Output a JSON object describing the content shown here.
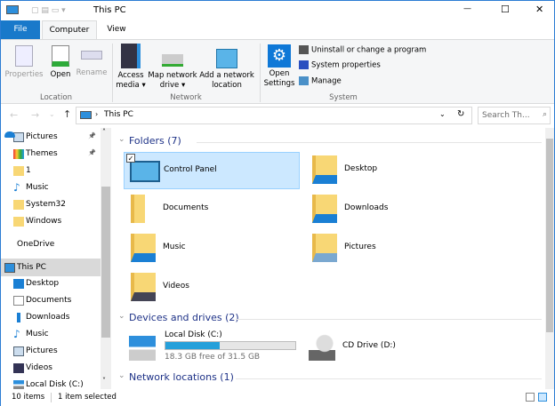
{
  "window": {
    "title": "This PC",
    "minimize": "—",
    "maximize": "☐",
    "close": "✕"
  },
  "tabs": [
    {
      "label": "File"
    },
    {
      "label": "Computer"
    },
    {
      "label": "View"
    }
  ],
  "ribbon": {
    "location": {
      "label": "Location",
      "buttons": [
        {
          "label": "Properties"
        },
        {
          "label": "Open"
        },
        {
          "label": "Rename"
        }
      ]
    },
    "network": {
      "label": "Network",
      "buttons": [
        {
          "label": "Access media ▾"
        },
        {
          "label": "Map network drive ▾"
        },
        {
          "label": "Add a network location"
        }
      ]
    },
    "system": {
      "label": "System",
      "open_settings": "Open Settings",
      "items": [
        {
          "label": "Uninstall or change a program"
        },
        {
          "label": "System properties"
        },
        {
          "label": "Manage"
        }
      ]
    }
  },
  "address": {
    "path": "This PC",
    "search_placeholder": "Search Th..."
  },
  "sidebar": {
    "items": [
      {
        "label": "Pictures",
        "icon": "pictures-icon",
        "pinned": true
      },
      {
        "label": "Themes",
        "icon": "themes-icon",
        "pinned": true
      },
      {
        "label": "1",
        "icon": "folder-icon"
      },
      {
        "label": "Music",
        "icon": "music-icon"
      },
      {
        "label": "System32",
        "icon": "folder-icon"
      },
      {
        "label": "Windows",
        "icon": "folder-icon"
      },
      {
        "label": "OneDrive",
        "icon": "onedrive-icon"
      },
      {
        "label": "This PC",
        "icon": "this-pc-icon",
        "selected": true
      },
      {
        "label": "Desktop",
        "icon": "desktop-icon"
      },
      {
        "label": "Documents",
        "icon": "documents-icon"
      },
      {
        "label": "Downloads",
        "icon": "downloads-icon"
      },
      {
        "label": "Music",
        "icon": "music-icon"
      },
      {
        "label": "Pictures",
        "icon": "pictures-icon"
      },
      {
        "label": "Videos",
        "icon": "videos-icon"
      },
      {
        "label": "Local Disk (C:)",
        "icon": "drive-icon"
      }
    ]
  },
  "content": {
    "folders_header": "Folders (7)",
    "folders": [
      {
        "label": "Control Panel",
        "selected": true
      },
      {
        "label": "Desktop"
      },
      {
        "label": "Documents"
      },
      {
        "label": "Downloads"
      },
      {
        "label": "Music"
      },
      {
        "label": "Pictures"
      },
      {
        "label": "Videos"
      }
    ],
    "devices_header": "Devices and drives (2)",
    "drives": [
      {
        "label": "Local Disk (C:)",
        "free": "18.3 GB free of 31.5 GB",
        "used_fraction": 0.42
      },
      {
        "label": "CD Drive (D:)"
      }
    ],
    "network_header": "Network locations (1)"
  },
  "status": {
    "count": "10 items",
    "selected": "1 item selected"
  },
  "colors": {
    "accent": "#1979ca",
    "selection": "#cce8ff",
    "drive_bar": "#26a0da"
  }
}
